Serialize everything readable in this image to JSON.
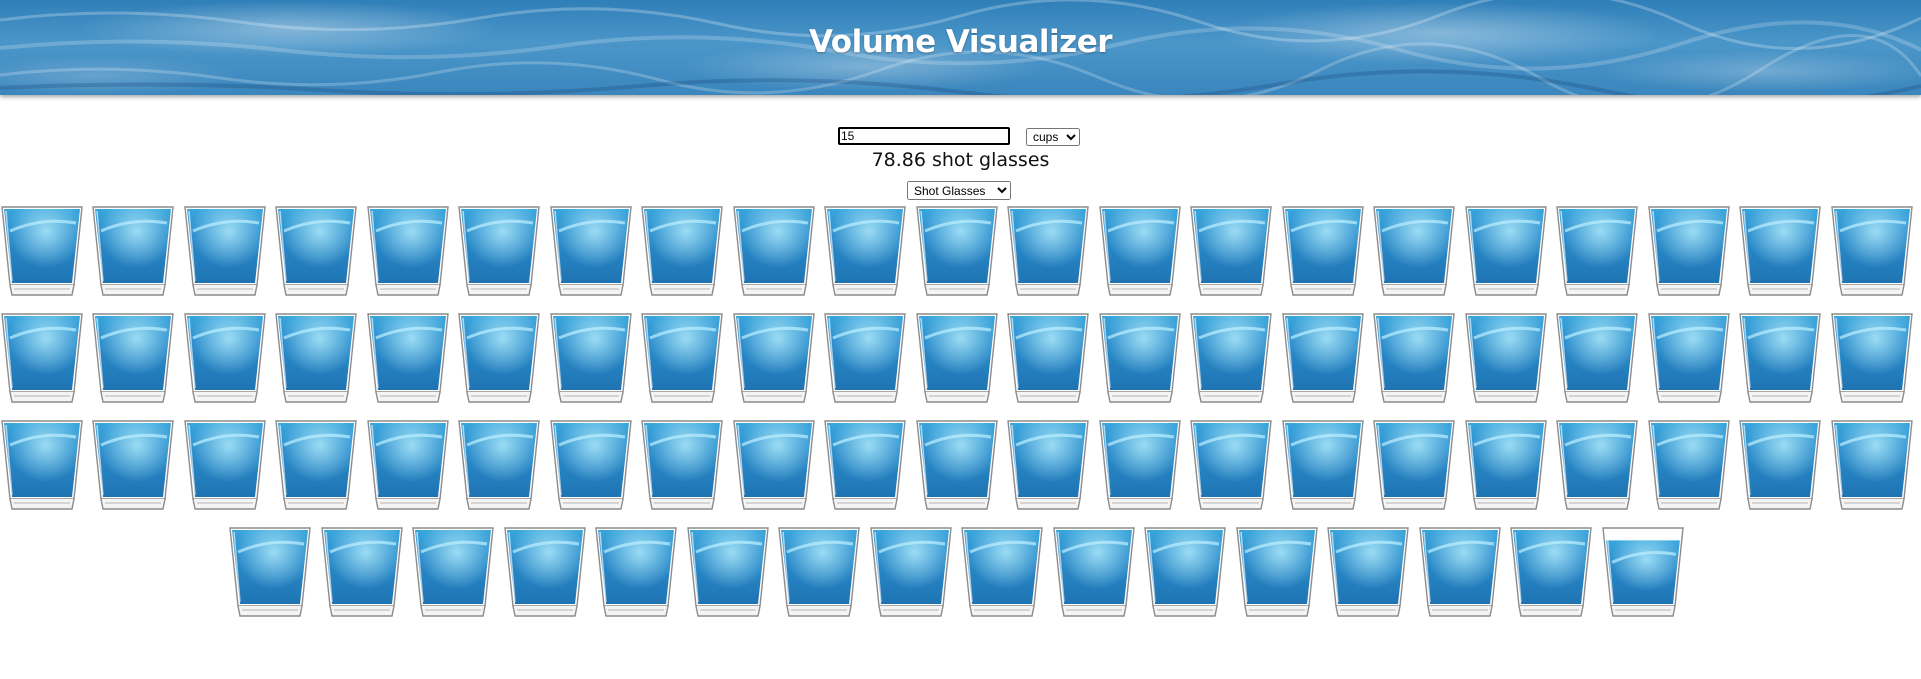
{
  "header": {
    "title": "Volume Visualizer"
  },
  "controls": {
    "amount_value": "15",
    "unit_selected": "cups",
    "container_selected": "Shot Glasses"
  },
  "result": {
    "text": "78.86 shot glasses",
    "value": 78.86,
    "unit": "shot glasses"
  },
  "visualization": {
    "icon": "shot-glass-icon",
    "full_glasses": 78,
    "partial_fill_fraction": 0.86,
    "liquid_color": "#2a8ccb",
    "liquid_highlight": "#7fd0f2"
  },
  "colors": {
    "header_bg": "#3a86bd",
    "title_text": "#ffffff"
  }
}
